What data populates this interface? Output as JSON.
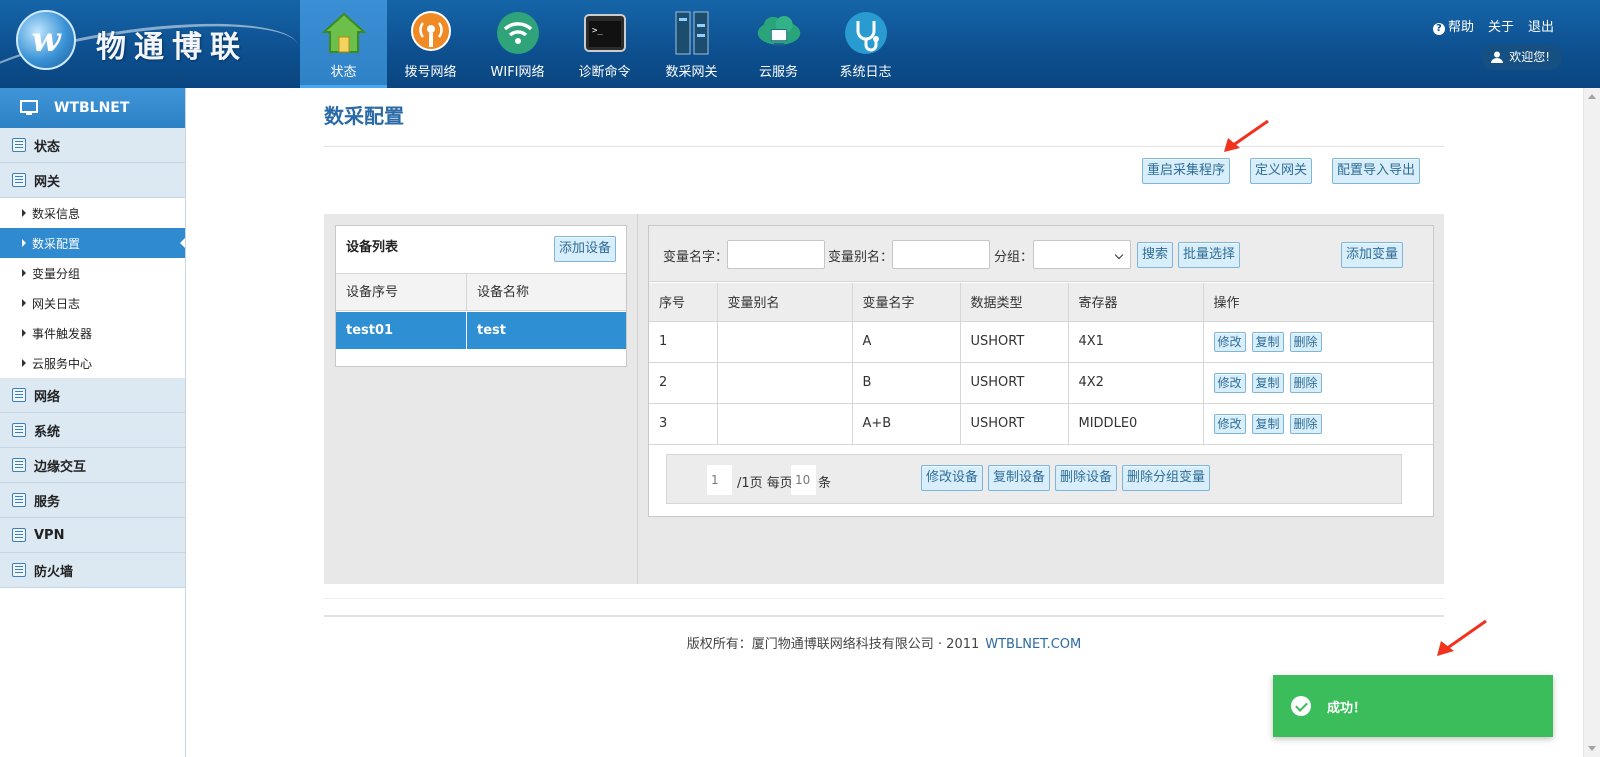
{
  "brand": {
    "logo_letter": "w",
    "name": "物通博联"
  },
  "nav": [
    {
      "label": "状态",
      "icon": "home-icon",
      "active": true
    },
    {
      "label": "拨号网络",
      "icon": "broadcast-icon"
    },
    {
      "label": "WIFI网络",
      "icon": "wifi-icon"
    },
    {
      "label": "诊断命令",
      "icon": "terminal-icon"
    },
    {
      "label": "数采网关",
      "icon": "gateway-device-icon"
    },
    {
      "label": "云服务",
      "icon": "cloud-icon"
    },
    {
      "label": "系统日志",
      "icon": "stethoscope-icon"
    }
  ],
  "top_links": {
    "help": "帮助",
    "about": "关于",
    "logout": "退出",
    "welcome": "欢迎您!"
  },
  "sidebar": {
    "title": "WTBLNET",
    "groups": [
      {
        "label": "状态"
      },
      {
        "label": "网关",
        "items": [
          "数采信息",
          "数采配置",
          "变量分组",
          "网关日志",
          "事件触发器",
          "云服务中心"
        ],
        "active_item": "数采配置"
      },
      {
        "label": "网络"
      },
      {
        "label": "系统"
      },
      {
        "label": "边缘交互"
      },
      {
        "label": "服务"
      },
      {
        "label": "VPN"
      },
      {
        "label": "防火墙"
      }
    ]
  },
  "page": {
    "title": "数采配置",
    "top_buttons": {
      "restart": "重启采集程序",
      "define_gateway": "定义网关",
      "import_export": "配置导入导出"
    }
  },
  "device_list": {
    "title": "设备列表",
    "add_button": "添加设备",
    "columns": [
      "设备序号",
      "设备名称"
    ],
    "rows": [
      {
        "id": "test01",
        "name": "test"
      }
    ]
  },
  "variables": {
    "search": {
      "name_label": "变量名字：",
      "alias_label": "变量别名：",
      "group_label": "分组：",
      "name_value": "",
      "alias_value": "",
      "group_value": "",
      "search_button": "搜索",
      "batch_button": "批量选择",
      "add_button": "添加变量"
    },
    "columns": [
      "序号",
      "变量别名",
      "变量名字",
      "数据类型",
      "寄存器",
      "操作"
    ],
    "rows": [
      {
        "no": "1",
        "alias": "",
        "name": "A",
        "type": "USHORT",
        "register": "4X1"
      },
      {
        "no": "2",
        "alias": "",
        "name": "B",
        "type": "USHORT",
        "register": "4X2"
      },
      {
        "no": "3",
        "alias": "",
        "name": "A+B",
        "type": "USHORT",
        "register": "MIDDLE0"
      }
    ],
    "row_actions": {
      "edit": "修改",
      "copy": "复制",
      "delete": "删除"
    },
    "pager": {
      "page": "1",
      "pages_text": "/1页 每页",
      "per_page": "10",
      "unit": "条",
      "buttons": {
        "edit_device": "修改设备",
        "copy_device": "复制设备",
        "delete_device": "删除设备",
        "delete_group_vars": "删除分组变量"
      }
    }
  },
  "footer": {
    "copyright": "版权所有：厦门物通博联网络科技有限公司 · 2011",
    "link": "WTBLNET.COM"
  },
  "toast": {
    "message": "成功！",
    "color": "#3cbd5b"
  },
  "colors": {
    "header": "#0d4f8f",
    "accent": "#2e8fd2",
    "annotation_arrow": "#f0321e"
  }
}
